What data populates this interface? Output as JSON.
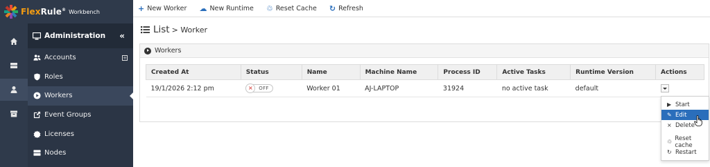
{
  "brand": {
    "name_part1": "Flex",
    "name_part2": "Rule",
    "reg": "®",
    "subtitle": "Workbench"
  },
  "sidebar": {
    "header": "Administration",
    "collapse_icon": "«",
    "items": [
      {
        "label": "Accounts",
        "icon": "users-icon",
        "extra": "+"
      },
      {
        "label": "Roles",
        "icon": "shield-icon"
      },
      {
        "label": "Workers",
        "icon": "play-circle-icon"
      },
      {
        "label": "Event Groups",
        "icon": "external-link-icon"
      },
      {
        "label": "Licenses",
        "icon": "badge-icon"
      },
      {
        "label": "Nodes",
        "icon": "server-icon"
      }
    ]
  },
  "toolbar": {
    "new_worker": {
      "icon": "+",
      "label": "New Worker"
    },
    "new_runtime": {
      "icon": "☁",
      "label": "New Runtime"
    },
    "reset_cache": {
      "icon": "♲",
      "label": "Reset Cache"
    },
    "refresh": {
      "icon": "↻",
      "label": "Refresh"
    }
  },
  "page": {
    "title": "List",
    "subtitle": "> Worker"
  },
  "panel": {
    "title": "Workers"
  },
  "table": {
    "headers": [
      "Created At",
      "Status",
      "Name",
      "Machine Name",
      "Process ID",
      "Active Tasks",
      "Runtime Version",
      "Actions"
    ],
    "rows": [
      {
        "created_at": "19/1/2026 2:12 pm",
        "status_x": "×",
        "status": "OFF",
        "name": "Worker 01",
        "machine": "AJ-LAPTOP",
        "pid": "31924",
        "tasks": "no active task",
        "runtime": "default"
      }
    ]
  },
  "actions_menu": [
    {
      "icon": "▶",
      "label": "Start"
    },
    {
      "icon": "✎",
      "label": "Edit"
    },
    {
      "icon": "×",
      "label": "Delete"
    },
    {
      "icon": "♲",
      "label": "Reset cache"
    },
    {
      "icon": "↻",
      "label": "Restart"
    }
  ],
  "colors": {
    "accent": "#2a6ebb",
    "sidebar_bg": "#2b3545",
    "rail_bg": "#2f3a4b",
    "brand_orange": "#f39c12"
  }
}
